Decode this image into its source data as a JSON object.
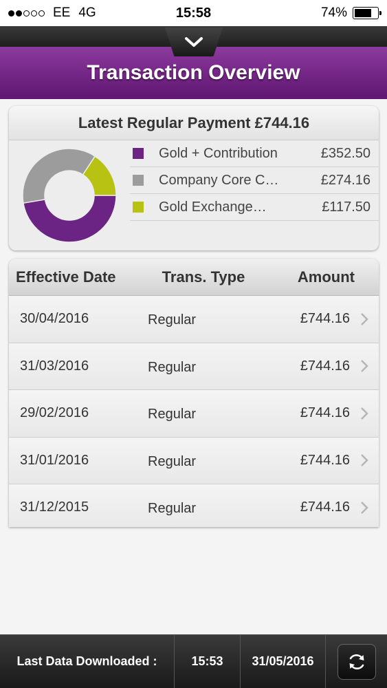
{
  "status_bar": {
    "carrier": "EE",
    "network": "4G",
    "time": "15:58",
    "battery": "74%",
    "battery_level": 0.74,
    "signal_bars": 2,
    "signal_total": 5
  },
  "header": {
    "title": "Transaction Overview"
  },
  "summary": {
    "title": "Latest Regular Payment £744.16",
    "items": [
      {
        "name": "Gold + Contribution",
        "value": "£352.50",
        "amount": 352.5,
        "color": "#6b2484"
      },
      {
        "name": "Company Core C…",
        "value": "£274.16",
        "amount": 274.16,
        "color": "#9c9c9c"
      },
      {
        "name": "Gold Exchange…",
        "value": "£117.50",
        "amount": 117.5,
        "color": "#b7c212"
      }
    ]
  },
  "table": {
    "headers": {
      "date": "Effective Date",
      "type": "Trans. Type",
      "amount": "Amount"
    },
    "rows": [
      {
        "date": "30/04/2016",
        "type": "Regular",
        "amount": "£744.16"
      },
      {
        "date": "31/03/2016",
        "type": "Regular",
        "amount": "£744.16"
      },
      {
        "date": "29/02/2016",
        "type": "Regular",
        "amount": "£744.16"
      },
      {
        "date": "31/01/2016",
        "type": "Regular",
        "amount": "£744.16"
      },
      {
        "date": "31/12/2015",
        "type": "Regular",
        "amount": "£744.16"
      }
    ]
  },
  "footer": {
    "label": "Last Data Downloaded :",
    "time": "15:53",
    "date": "31/05/2016",
    "refresh_icon": "refresh-icon"
  },
  "colors": {
    "brand_purple": "#7a2a8f",
    "brand_purple_dark": "#5e1670"
  }
}
